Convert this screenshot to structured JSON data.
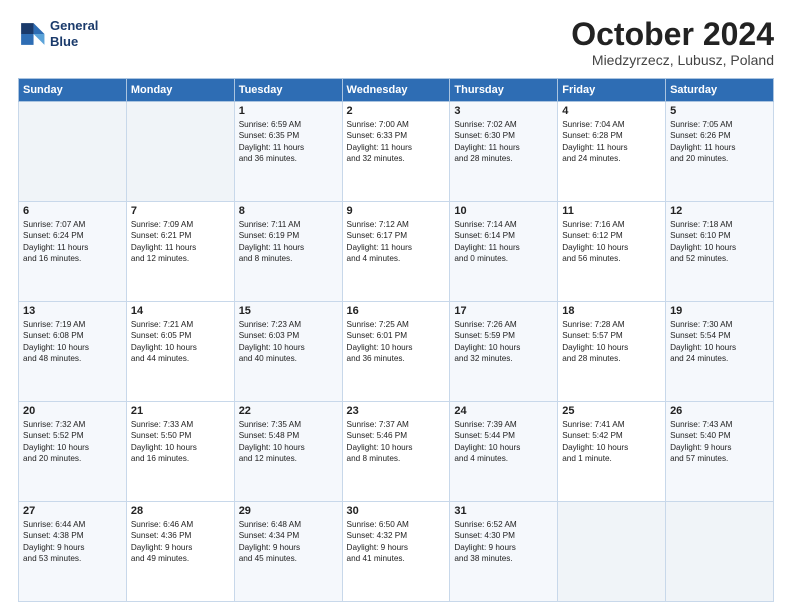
{
  "logo": {
    "line1": "General",
    "line2": "Blue"
  },
  "title": "October 2024",
  "location": "Miedzyrzecz, Lubusz, Poland",
  "days_header": [
    "Sunday",
    "Monday",
    "Tuesday",
    "Wednesday",
    "Thursday",
    "Friday",
    "Saturday"
  ],
  "weeks": [
    [
      {
        "day": "",
        "content": ""
      },
      {
        "day": "",
        "content": ""
      },
      {
        "day": "1",
        "content": "Sunrise: 6:59 AM\nSunset: 6:35 PM\nDaylight: 11 hours\nand 36 minutes."
      },
      {
        "day": "2",
        "content": "Sunrise: 7:00 AM\nSunset: 6:33 PM\nDaylight: 11 hours\nand 32 minutes."
      },
      {
        "day": "3",
        "content": "Sunrise: 7:02 AM\nSunset: 6:30 PM\nDaylight: 11 hours\nand 28 minutes."
      },
      {
        "day": "4",
        "content": "Sunrise: 7:04 AM\nSunset: 6:28 PM\nDaylight: 11 hours\nand 24 minutes."
      },
      {
        "day": "5",
        "content": "Sunrise: 7:05 AM\nSunset: 6:26 PM\nDaylight: 11 hours\nand 20 minutes."
      }
    ],
    [
      {
        "day": "6",
        "content": "Sunrise: 7:07 AM\nSunset: 6:24 PM\nDaylight: 11 hours\nand 16 minutes."
      },
      {
        "day": "7",
        "content": "Sunrise: 7:09 AM\nSunset: 6:21 PM\nDaylight: 11 hours\nand 12 minutes."
      },
      {
        "day": "8",
        "content": "Sunrise: 7:11 AM\nSunset: 6:19 PM\nDaylight: 11 hours\nand 8 minutes."
      },
      {
        "day": "9",
        "content": "Sunrise: 7:12 AM\nSunset: 6:17 PM\nDaylight: 11 hours\nand 4 minutes."
      },
      {
        "day": "10",
        "content": "Sunrise: 7:14 AM\nSunset: 6:14 PM\nDaylight: 11 hours\nand 0 minutes."
      },
      {
        "day": "11",
        "content": "Sunrise: 7:16 AM\nSunset: 6:12 PM\nDaylight: 10 hours\nand 56 minutes."
      },
      {
        "day": "12",
        "content": "Sunrise: 7:18 AM\nSunset: 6:10 PM\nDaylight: 10 hours\nand 52 minutes."
      }
    ],
    [
      {
        "day": "13",
        "content": "Sunrise: 7:19 AM\nSunset: 6:08 PM\nDaylight: 10 hours\nand 48 minutes."
      },
      {
        "day": "14",
        "content": "Sunrise: 7:21 AM\nSunset: 6:05 PM\nDaylight: 10 hours\nand 44 minutes."
      },
      {
        "day": "15",
        "content": "Sunrise: 7:23 AM\nSunset: 6:03 PM\nDaylight: 10 hours\nand 40 minutes."
      },
      {
        "day": "16",
        "content": "Sunrise: 7:25 AM\nSunset: 6:01 PM\nDaylight: 10 hours\nand 36 minutes."
      },
      {
        "day": "17",
        "content": "Sunrise: 7:26 AM\nSunset: 5:59 PM\nDaylight: 10 hours\nand 32 minutes."
      },
      {
        "day": "18",
        "content": "Sunrise: 7:28 AM\nSunset: 5:57 PM\nDaylight: 10 hours\nand 28 minutes."
      },
      {
        "day": "19",
        "content": "Sunrise: 7:30 AM\nSunset: 5:54 PM\nDaylight: 10 hours\nand 24 minutes."
      }
    ],
    [
      {
        "day": "20",
        "content": "Sunrise: 7:32 AM\nSunset: 5:52 PM\nDaylight: 10 hours\nand 20 minutes."
      },
      {
        "day": "21",
        "content": "Sunrise: 7:33 AM\nSunset: 5:50 PM\nDaylight: 10 hours\nand 16 minutes."
      },
      {
        "day": "22",
        "content": "Sunrise: 7:35 AM\nSunset: 5:48 PM\nDaylight: 10 hours\nand 12 minutes."
      },
      {
        "day": "23",
        "content": "Sunrise: 7:37 AM\nSunset: 5:46 PM\nDaylight: 10 hours\nand 8 minutes."
      },
      {
        "day": "24",
        "content": "Sunrise: 7:39 AM\nSunset: 5:44 PM\nDaylight: 10 hours\nand 4 minutes."
      },
      {
        "day": "25",
        "content": "Sunrise: 7:41 AM\nSunset: 5:42 PM\nDaylight: 10 hours\nand 1 minute."
      },
      {
        "day": "26",
        "content": "Sunrise: 7:43 AM\nSunset: 5:40 PM\nDaylight: 9 hours\nand 57 minutes."
      }
    ],
    [
      {
        "day": "27",
        "content": "Sunrise: 6:44 AM\nSunset: 4:38 PM\nDaylight: 9 hours\nand 53 minutes."
      },
      {
        "day": "28",
        "content": "Sunrise: 6:46 AM\nSunset: 4:36 PM\nDaylight: 9 hours\nand 49 minutes."
      },
      {
        "day": "29",
        "content": "Sunrise: 6:48 AM\nSunset: 4:34 PM\nDaylight: 9 hours\nand 45 minutes."
      },
      {
        "day": "30",
        "content": "Sunrise: 6:50 AM\nSunset: 4:32 PM\nDaylight: 9 hours\nand 41 minutes."
      },
      {
        "day": "31",
        "content": "Sunrise: 6:52 AM\nSunset: 4:30 PM\nDaylight: 9 hours\nand 38 minutes."
      },
      {
        "day": "",
        "content": ""
      },
      {
        "day": "",
        "content": ""
      }
    ]
  ]
}
